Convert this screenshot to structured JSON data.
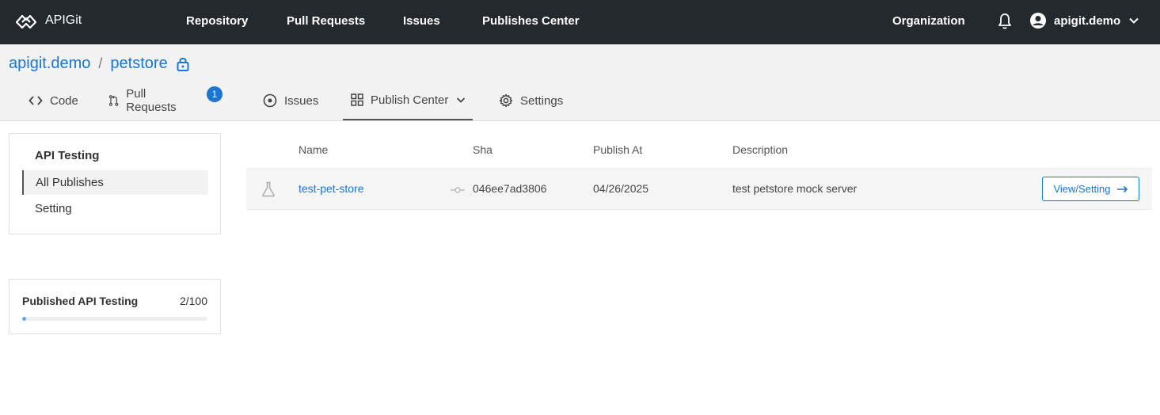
{
  "app": {
    "name": "APIGit"
  },
  "topnav": {
    "items": [
      "Repository",
      "Pull Requests",
      "Issues",
      "Publishes Center"
    ],
    "organization": "Organization",
    "user": "apigit.demo"
  },
  "breadcrumb": {
    "owner": "apigit.demo",
    "separator": "/",
    "repo": "petstore"
  },
  "tabs": [
    {
      "label": "Code"
    },
    {
      "label": "Pull Requests",
      "badge": "1"
    },
    {
      "label": "Issues"
    },
    {
      "label": "Publish Center"
    },
    {
      "label": "Settings"
    }
  ],
  "sidebar": {
    "title": "API Testing",
    "items": [
      {
        "label": "All Publishes"
      },
      {
        "label": "Setting"
      }
    ]
  },
  "quota": {
    "label": "Published API Testing",
    "count": "2/100",
    "fraction": 0.02
  },
  "table": {
    "headers": [
      "Name",
      "Sha",
      "Publish At",
      "Description"
    ],
    "rows": [
      {
        "name": "test-pet-store",
        "sha": "046ee7ad3806",
        "publish_at": "04/26/2025",
        "description": "test petstore mock server",
        "action": "View/Setting"
      }
    ]
  },
  "colors": {
    "accent": "#1976d2",
    "topbar": "#24292e"
  }
}
